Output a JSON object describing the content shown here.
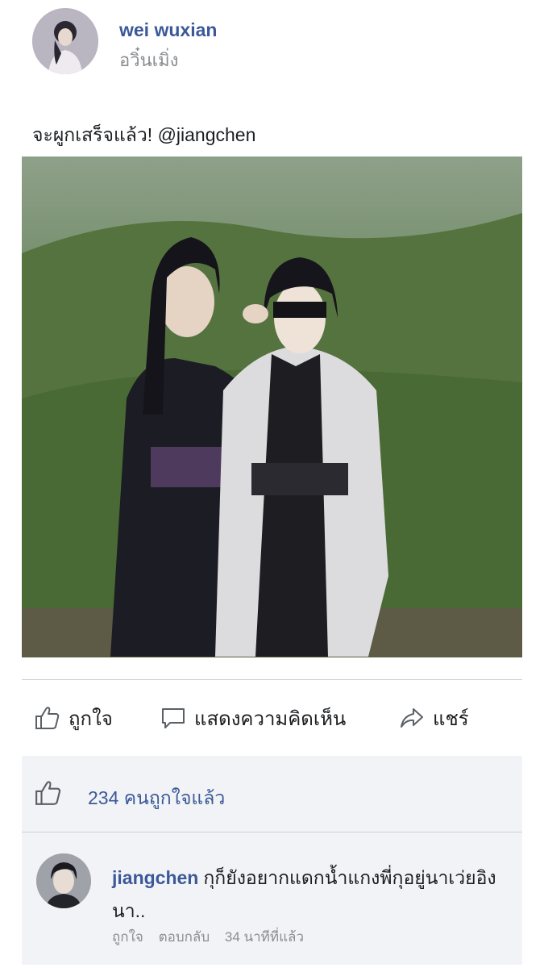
{
  "post": {
    "author_name": "wei wuxian",
    "author_subname": "อวิ๋นเมิ่ง",
    "caption": "จะผูกเสร็จแล้ว! @jiangchen",
    "image_icon": "photo-two-people"
  },
  "actions": {
    "like_label": "ถูกใจ",
    "comment_label": "แสดงความคิดเห็น",
    "share_label": "แชร์",
    "like_icon": "thumbs-up-icon",
    "comment_icon": "speech-bubble-icon",
    "share_icon": "share-arrow-icon"
  },
  "likes": {
    "summary": "234 คนถูกใจแล้ว"
  },
  "comment": {
    "author": "jiangchen",
    "text": "กุก็ยังอยากแดกน้ำแกงพี่กุอยู่นาเว่ยอิงนา..",
    "like_label": "ถูกใจ",
    "reply_label": "ตอบกลับ",
    "time": "34 นาทีที่แล้ว"
  },
  "colors": {
    "accent": "#3b5998",
    "muted": "#8a8d91",
    "panel_bg": "#f2f3f6"
  }
}
